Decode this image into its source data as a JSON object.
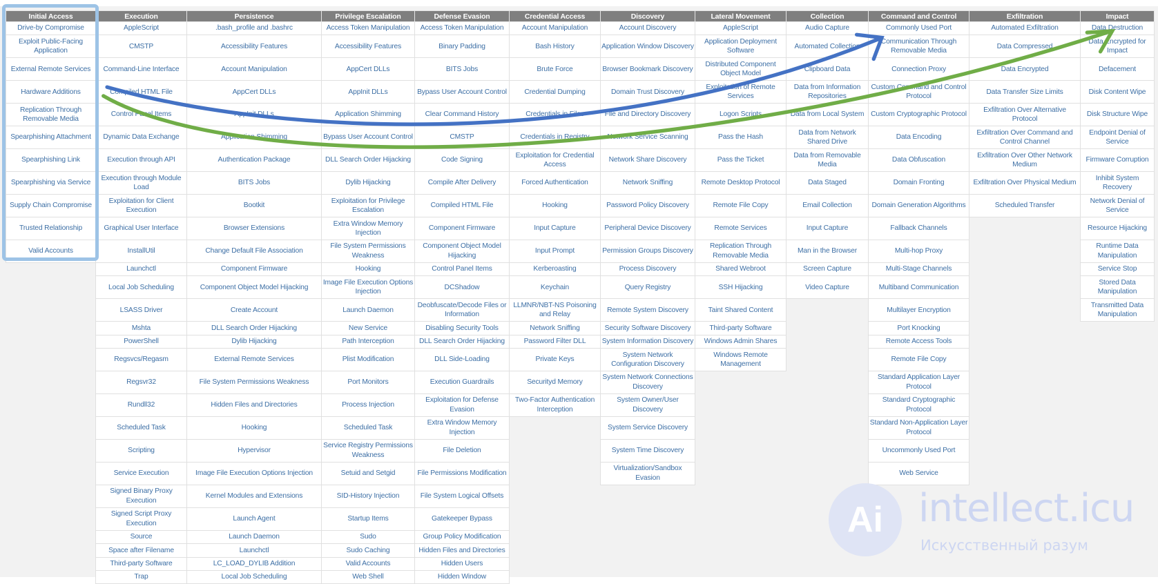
{
  "matrix": {
    "columns": [
      {
        "tactic": "Initial Access",
        "techniques": [
          "Drive-by Compromise",
          "Exploit Public-Facing Application",
          "External Remote Services",
          "Hardware Additions",
          "Replication Through Removable Media",
          "Spearphishing Attachment",
          "Spearphishing Link",
          "Spearphishing via Service",
          "Supply Chain Compromise",
          "Trusted Relationship",
          "Valid Accounts"
        ]
      },
      {
        "tactic": "Execution",
        "techniques": [
          "AppleScript",
          "CMSTP",
          "Command-Line Interface",
          "Compiled HTML File",
          "Control Panel Items",
          "Dynamic Data Exchange",
          "Execution through API",
          "Execution through Module Load",
          "Exploitation for Client Execution",
          "Graphical User Interface",
          "InstallUtil",
          "Launchctl",
          "Local Job Scheduling",
          "LSASS Driver",
          "Mshta",
          "PowerShell",
          "Regsvcs/Regasm",
          "Regsvr32",
          "Rundll32",
          "Scheduled Task",
          "Scripting",
          "Service Execution",
          "Signed Binary Proxy Execution",
          "Signed Script Proxy Execution",
          "Source",
          "Space after Filename",
          "Third-party Software",
          "Trap"
        ]
      },
      {
        "tactic": "Persistence",
        "techniques": [
          ".bash_profile and .bashrc",
          "Accessibility Features",
          "Account Manipulation",
          "AppCert DLLs",
          "AppInit DLLs",
          "Application Shimming",
          "Authentication Package",
          "BITS Jobs",
          "Bootkit",
          "Browser Extensions",
          "Change Default File Association",
          "Component Firmware",
          "Component Object Model Hijacking",
          "Create Account",
          "DLL Search Order Hijacking",
          "Dylib Hijacking",
          "External Remote Services",
          "File System Permissions Weakness",
          "Hidden Files and Directories",
          "Hooking",
          "Hypervisor",
          "Image File Execution Options Injection",
          "Kernel Modules and Extensions",
          "Launch Agent",
          "Launch Daemon",
          "Launchctl",
          "LC_LOAD_DYLIB Addition",
          "Local Job Scheduling"
        ]
      },
      {
        "tactic": "Privilege Escalation",
        "techniques": [
          "Access Token Manipulation",
          "Accessibility Features",
          "AppCert DLLs",
          "AppInit DLLs",
          "Application Shimming",
          "Bypass User Account Control",
          "DLL Search Order Hijacking",
          "Dylib Hijacking",
          "Exploitation for Privilege Escalation",
          "Extra Window Memory Injection",
          "File System Permissions Weakness",
          "Hooking",
          "Image File Execution Options Injection",
          "Launch Daemon",
          "New Service",
          "Path Interception",
          "Plist Modification",
          "Port Monitors",
          "Process Injection",
          "Scheduled Task",
          "Service Registry Permissions Weakness",
          "Setuid and Setgid",
          "SID-History Injection",
          "Startup Items",
          "Sudo",
          "Sudo Caching",
          "Valid Accounts",
          "Web Shell"
        ]
      },
      {
        "tactic": "Defense Evasion",
        "techniques": [
          "Access Token Manipulation",
          "Binary Padding",
          "BITS Jobs",
          "Bypass User Account Control",
          "Clear Command History",
          "CMSTP",
          "Code Signing",
          "Compile After Delivery",
          "Compiled HTML File",
          "Component Firmware",
          "Component Object Model Hijacking",
          "Control Panel Items",
          "DCShadow",
          "Deobfuscate/Decode Files or Information",
          "Disabling Security Tools",
          "DLL Search Order Hijacking",
          "DLL Side-Loading",
          "Execution Guardrails",
          "Exploitation for Defense Evasion",
          "Extra Window Memory Injection",
          "File Deletion",
          "File Permissions Modification",
          "File System Logical Offsets",
          "Gatekeeper Bypass",
          "Group Policy Modification",
          "Hidden Files and Directories",
          "Hidden Users",
          "Hidden Window"
        ]
      },
      {
        "tactic": "Credential Access",
        "techniques": [
          "Account Manipulation",
          "Bash History",
          "Brute Force",
          "Credential Dumping",
          "Credentials in Files",
          "Credentials in Registry",
          "Exploitation for Credential Access",
          "Forced Authentication",
          "Hooking",
          "Input Capture",
          "Input Prompt",
          "Kerberoasting",
          "Keychain",
          "LLMNR/NBT-NS Poisoning and Relay",
          "Network Sniffing",
          "Password Filter DLL",
          "Private Keys",
          "Securityd Memory",
          "Two-Factor Authentication Interception"
        ]
      },
      {
        "tactic": "Discovery",
        "techniques": [
          "Account Discovery",
          "Application Window Discovery",
          "Browser Bookmark Discovery",
          "Domain Trust Discovery",
          "File and Directory Discovery",
          "Network Service Scanning",
          "Network Share Discovery",
          "Network Sniffing",
          "Password Policy Discovery",
          "Peripheral Device Discovery",
          "Permission Groups Discovery",
          "Process Discovery",
          "Query Registry",
          "Remote System Discovery",
          "Security Software Discovery",
          "System Information Discovery",
          "System Network Configuration Discovery",
          "System Network Connections Discovery",
          "System Owner/User Discovery",
          "System Service Discovery",
          "System Time Discovery",
          "Virtualization/Sandbox Evasion"
        ]
      },
      {
        "tactic": "Lateral Movement",
        "techniques": [
          "AppleScript",
          "Application Deployment Software",
          "Distributed Component Object Model",
          "Exploitation of Remote Services",
          "Logon Scripts",
          "Pass the Hash",
          "Pass the Ticket",
          "Remote Desktop Protocol",
          "Remote File Copy",
          "Remote Services",
          "Replication Through Removable Media",
          "Shared Webroot",
          "SSH Hijacking",
          "Taint Shared Content",
          "Third-party Software",
          "Windows Admin Shares",
          "Windows Remote Management"
        ]
      },
      {
        "tactic": "Collection",
        "techniques": [
          "Audio Capture",
          "Automated Collection",
          "Clipboard Data",
          "Data from Information Repositories",
          "Data from Local System",
          "Data from Network Shared Drive",
          "Data from Removable Media",
          "Data Staged",
          "Email Collection",
          "Input Capture",
          "Man in the Browser",
          "Screen Capture",
          "Video Capture"
        ]
      },
      {
        "tactic": "Command and Control",
        "techniques": [
          "Commonly Used Port",
          "Communication Through Removable Media",
          "Connection Proxy",
          "Custom Command and Control Protocol",
          "Custom Cryptographic Protocol",
          "Data Encoding",
          "Data Obfuscation",
          "Domain Fronting",
          "Domain Generation Algorithms",
          "Fallback Channels",
          "Multi-hop Proxy",
          "Multi-Stage Channels",
          "Multiband Communication",
          "Multilayer Encryption",
          "Port Knocking",
          "Remote Access Tools",
          "Remote File Copy",
          "Standard Application Layer Protocol",
          "Standard Cryptographic Protocol",
          "Standard Non-Application Layer Protocol",
          "Uncommonly Used Port",
          "Web Service"
        ]
      },
      {
        "tactic": "Exfiltration",
        "techniques": [
          "Automated Exfiltration",
          "Data Compressed",
          "Data Encrypted",
          "Data Transfer Size Limits",
          "Exfiltration Over Alternative Protocol",
          "Exfiltration Over Command and Control Channel",
          "Exfiltration Over Other Network Medium",
          "Exfiltration Over Physical Medium",
          "Scheduled Transfer"
        ]
      },
      {
        "tactic": "Impact",
        "techniques": [
          "Data Destruction",
          "Data Encrypted for Impact",
          "Defacement",
          "Disk Content Wipe",
          "Disk Structure Wipe",
          "Endpoint Denial of Service",
          "Firmware Corruption",
          "Inhibit System Recovery",
          "Network Denial of Service",
          "Resource Hijacking",
          "Runtime Data Manipulation",
          "Service Stop",
          "Stored Data Manipulation",
          "Transmitted Data Manipulation"
        ]
      }
    ]
  },
  "annotations": {
    "highlight_column": "Initial Access",
    "arrow_blue": {
      "from": "Compiled HTML File",
      "to": "Commonly Used Port",
      "color": "#4472c4"
    },
    "arrow_green": {
      "from": "Compiled HTML File",
      "to": "Data Destruction",
      "color": "#70ad47"
    },
    "highlight_color": "#9dc3e6"
  },
  "colors": {
    "header_bg": "#7f7f7f",
    "link": "#3d6fa5",
    "page_bg": "#f2f2f2"
  },
  "watermark": {
    "logo": "Ai",
    "title": "intellect.icu",
    "subtitle": "Искусственный разум"
  }
}
